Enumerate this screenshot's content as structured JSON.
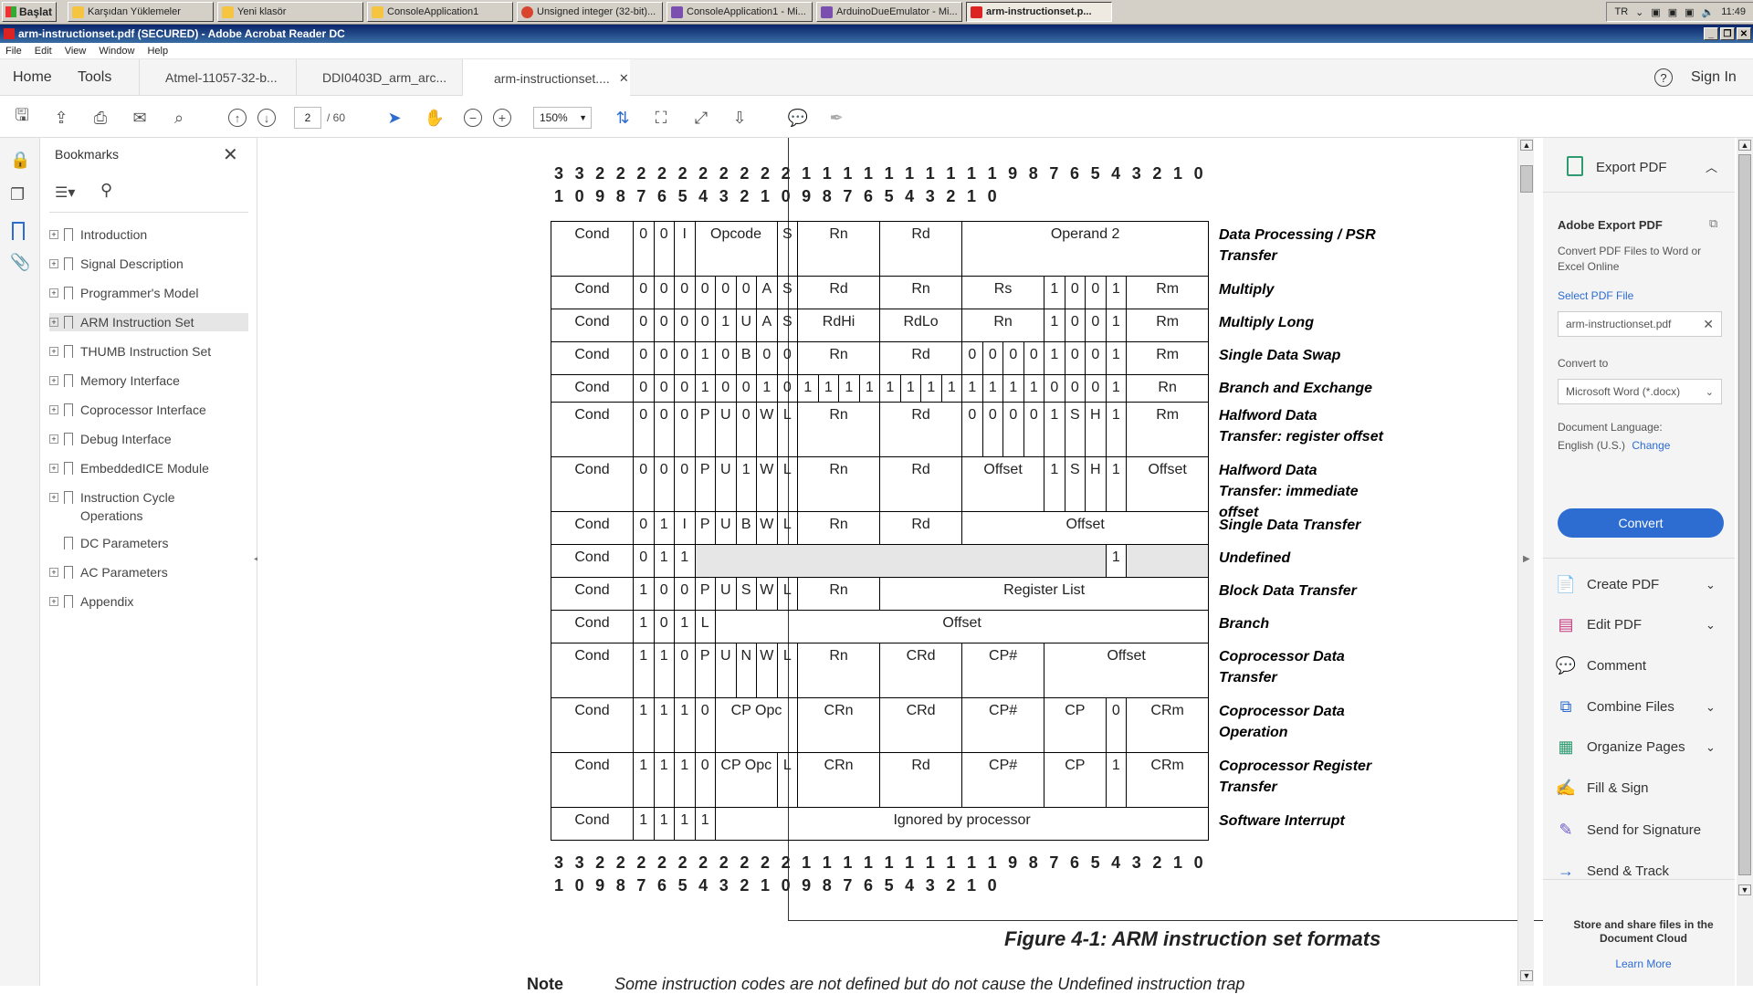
{
  "taskbar": {
    "start": "Başlat",
    "items": [
      "Karşıdan Yüklemeler",
      "Yeni klasör",
      "ConsoleApplication1",
      "Unsigned integer (32-bit)...",
      "ConsoleApplication1 - Mi...",
      "ArduinoDueEmulator - Mi...",
      "arm-instructionset.p..."
    ],
    "lang": "TR",
    "clock": "11:49"
  },
  "window": {
    "title": "arm-instructionset.pdf (SECURED) - Adobe Acrobat Reader DC"
  },
  "menu": [
    "File",
    "Edit",
    "View",
    "Window",
    "Help"
  ],
  "tabs": {
    "home": "Home",
    "tools": "Tools",
    "docs": [
      "Atmel-11057-32-b...",
      "DDI0403D_arm_arc...",
      "arm-instructionset...."
    ],
    "signin": "Sign In"
  },
  "toolbar": {
    "page": "2",
    "pages": "/ 60",
    "zoom": "150%"
  },
  "bookmarks": {
    "title": "Bookmarks",
    "items": [
      {
        "label": "Introduction",
        "expand": true
      },
      {
        "label": "Signal Description",
        "expand": true
      },
      {
        "label": "Programmer's Model",
        "expand": true
      },
      {
        "label": "ARM Instruction Set",
        "expand": true,
        "selected": true
      },
      {
        "label": "THUMB Instruction Set",
        "expand": true
      },
      {
        "label": "Memory Interface",
        "expand": true
      },
      {
        "label": "Coprocessor Interface",
        "expand": true
      },
      {
        "label": "Debug Interface",
        "expand": true
      },
      {
        "label": "EmbeddedICE Module",
        "expand": true
      },
      {
        "label": "Instruction Cycle Operations",
        "expand": true
      },
      {
        "label": "DC Parameters",
        "expand": false
      },
      {
        "label": "AC Parameters",
        "expand": true
      },
      {
        "label": "Appendix",
        "expand": true
      }
    ]
  },
  "doc": {
    "bits_top": [
      "3",
      "3",
      "2",
      "2",
      "2",
      "2",
      "2",
      "2",
      "2",
      "2",
      "2",
      "2",
      "1",
      "1",
      "1",
      "1",
      "1",
      "1",
      "1",
      "1",
      "1",
      "1",
      "9",
      "8",
      "7",
      "6",
      "5",
      "4",
      "3",
      "2",
      "1",
      "0"
    ],
    "bits_bot": [
      "1",
      "0",
      "9",
      "8",
      "7",
      "6",
      "5",
      "4",
      "3",
      "2",
      "1",
      "0",
      "9",
      "8",
      "7",
      "6",
      "5",
      "4",
      "3",
      "2",
      "1",
      "0"
    ],
    "formats": [
      {
        "name": "Data Processing / PSR Transfer",
        "cells": [
          "Cond",
          "0",
          "0",
          "I",
          "Opcode",
          "S",
          "Rn",
          "Rd",
          "Operand 2"
        ]
      },
      {
        "name": "Multiply",
        "cells": [
          "Cond",
          "0",
          "0",
          "0",
          "0",
          "0",
          "0",
          "A",
          "S",
          "Rd",
          "Rn",
          "Rs",
          "1",
          "0",
          "0",
          "1",
          "Rm"
        ]
      },
      {
        "name": "Multiply Long",
        "cells": [
          "Cond",
          "0",
          "0",
          "0",
          "0",
          "1",
          "U",
          "A",
          "S",
          "RdHi",
          "RdLo",
          "Rn",
          "1",
          "0",
          "0",
          "1",
          "Rm"
        ]
      },
      {
        "name": "Single Data Swap",
        "cells": [
          "Cond",
          "0",
          "0",
          "0",
          "1",
          "0",
          "B",
          "0",
          "0",
          "Rn",
          "Rd",
          "0",
          "0",
          "0",
          "0",
          "1",
          "0",
          "0",
          "1",
          "Rm"
        ]
      },
      {
        "name": "Branch and Exchange",
        "cells": [
          "Cond",
          "0",
          "0",
          "0",
          "1",
          "0",
          "0",
          "1",
          "0",
          "1",
          "1",
          "1",
          "1",
          "1",
          "1",
          "1",
          "1",
          "1",
          "1",
          "1",
          "1",
          "0",
          "0",
          "0",
          "1",
          "Rn"
        ]
      },
      {
        "name": "Halfword Data Transfer: register offset",
        "cells": [
          "Cond",
          "0",
          "0",
          "0",
          "P",
          "U",
          "0",
          "W",
          "L",
          "Rn",
          "Rd",
          "0",
          "0",
          "0",
          "0",
          "1",
          "S",
          "H",
          "1",
          "Rm"
        ]
      },
      {
        "name": "Halfword Data Transfer: immediate offset",
        "cells": [
          "Cond",
          "0",
          "0",
          "0",
          "P",
          "U",
          "1",
          "W",
          "L",
          "Rn",
          "Rd",
          "Offset",
          "1",
          "S",
          "H",
          "1",
          "Offset"
        ]
      },
      {
        "name": "Single Data Transfer",
        "cells": [
          "Cond",
          "0",
          "1",
          "I",
          "P",
          "U",
          "B",
          "W",
          "L",
          "Rn",
          "Rd",
          "Offset"
        ]
      },
      {
        "name": "Undefined",
        "cells": [
          "Cond",
          "0",
          "1",
          "1",
          "",
          "1",
          ""
        ]
      },
      {
        "name": "Block Data Transfer",
        "cells": [
          "Cond",
          "1",
          "0",
          "0",
          "P",
          "U",
          "S",
          "W",
          "L",
          "Rn",
          "Register List"
        ]
      },
      {
        "name": "Branch",
        "cells": [
          "Cond",
          "1",
          "0",
          "1",
          "L",
          "Offset"
        ]
      },
      {
        "name": "Coprocessor Data Transfer",
        "cells": [
          "Cond",
          "1",
          "1",
          "0",
          "P",
          "U",
          "N",
          "W",
          "L",
          "Rn",
          "CRd",
          "CP#",
          "Offset"
        ]
      },
      {
        "name": "Coprocessor Data Operation",
        "cells": [
          "Cond",
          "1",
          "1",
          "1",
          "0",
          "CP Opc",
          "CRn",
          "CRd",
          "CP#",
          "CP",
          "0",
          "CRm"
        ]
      },
      {
        "name": "Coprocessor Register Transfer",
        "cells": [
          "Cond",
          "1",
          "1",
          "1",
          "0",
          "CP Opc",
          "L",
          "CRn",
          "Rd",
          "CP#",
          "CP",
          "1",
          "CRm"
        ]
      },
      {
        "name": "Software Interrupt",
        "cells": [
          "Cond",
          "1",
          "1",
          "1",
          "1",
          "Ignored by processor"
        ]
      }
    ],
    "caption": "Figure 4-1: ARM instruction set formats",
    "note_label": "Note",
    "note_text": "Some instruction codes are not defined but do not cause the Undefined instruction trap"
  },
  "rightpanel": {
    "export_header": "Export PDF",
    "adobe_export": "Adobe Export PDF",
    "convert_desc": "Convert PDF Files to Word or Excel Online",
    "select_file": "Select PDF File",
    "file_name": "arm-instructionset.pdf",
    "convert_to": "Convert to",
    "format": "Microsoft Word (*.docx)",
    "doc_lang_label": "Document Language:",
    "doc_lang": "English (U.S.)",
    "change": "Change",
    "convert_btn": "Convert",
    "tools": [
      "Create PDF",
      "Edit PDF",
      "Comment",
      "Combine Files",
      "Organize Pages",
      "Fill & Sign",
      "Send for Signature",
      "Send & Track"
    ],
    "store": "Store and share files in the Document Cloud",
    "learn": "Learn More"
  },
  "colors": {
    "accent": "#2d6cd1",
    "select": "#e6e6e6"
  }
}
